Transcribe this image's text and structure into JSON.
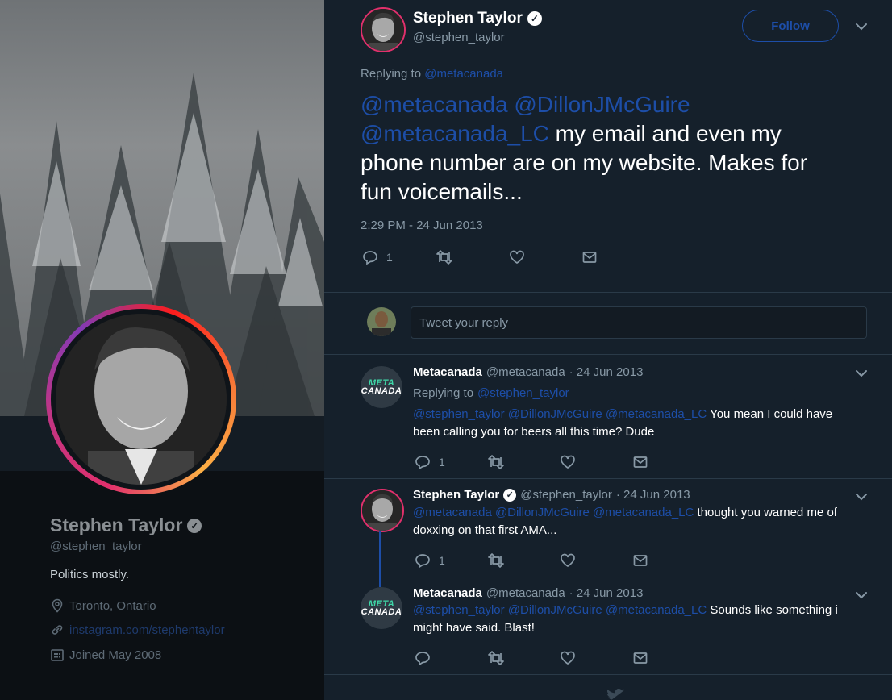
{
  "profile": {
    "name": "Stephen Taylor",
    "handle": "@stephen_taylor",
    "bio": "Politics mostly.",
    "location": "Toronto, Ontario",
    "website": "instagram.com/stephentaylor",
    "joined": "Joined May 2008"
  },
  "main_tweet": {
    "author_name": "Stephen Taylor",
    "author_handle": "@stephen_taylor",
    "follow_label": "Follow",
    "replying_to_label": "Replying to",
    "replying_to_handle": "@metacanada",
    "mentions_line1": "@metacanada @DillonJMcGuire",
    "mention3": "@metacanada_LC",
    "text_a": " my email and even my",
    "text_b": "phone number are on my website. Makes for",
    "text_c": "fun voicemails...",
    "timestamp": "2:29 PM - 24 Jun 2013",
    "reply_count": "1"
  },
  "reply_box": {
    "placeholder": "Tweet your reply"
  },
  "replies": [
    {
      "name": "Metacanada",
      "handle": "@metacanada",
      "date": "· 24 Jun 2013",
      "replying_label": "Replying to",
      "replying_handle": "@stephen_taylor",
      "mentions": "@stephen_taylor @DillonJMcGuire @metacanada_LC",
      "text": " You mean I could have been calling you for beers all this time? Dude",
      "reply_count": "1",
      "logo_top": "META",
      "logo_bottom": "CANADA"
    },
    {
      "name": "Stephen Taylor",
      "handle": "@stephen_taylor",
      "date": "· 24 Jun 2013",
      "mentions": "@metacanada @DillonJMcGuire @metacanada_LC",
      "text": " thought you warned me of doxxing on that first AMA...",
      "reply_count": "1"
    },
    {
      "name": "Metacanada",
      "handle": "@metacanada",
      "date": "· 24 Jun 2013",
      "mentions": "@stephen_taylor @DillonJMcGuire @metacanada_LC",
      "text": " Sounds like something i might have said.  Blast!",
      "logo_top": "META",
      "logo_bottom": "CANADA"
    }
  ],
  "icons": {
    "verified": "✓",
    "chevron": "⌄",
    "bird": "twitter-bird-icon"
  },
  "colors": {
    "link": "#1d4ea8",
    "background": "#15202b",
    "accent_ring": "#e1306c"
  }
}
